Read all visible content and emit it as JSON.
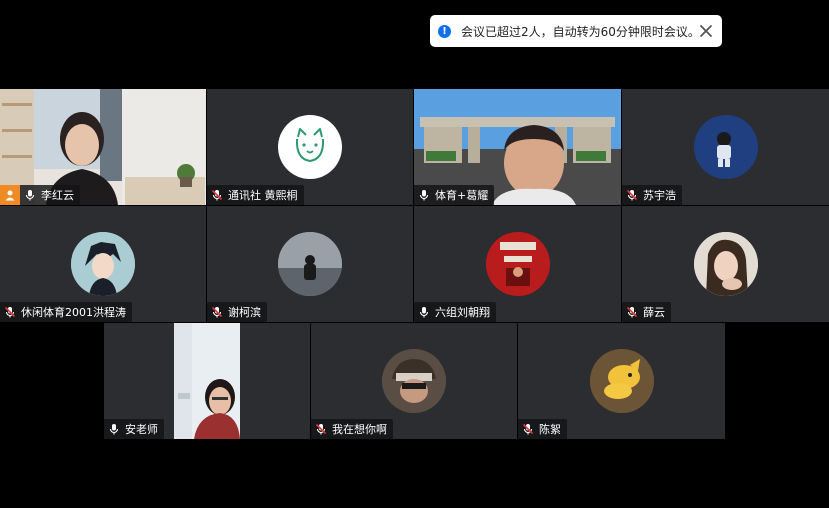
{
  "notification": {
    "message": "会议已超过2人，自动转为60分钟限时会议。",
    "info_icon": "info-icon",
    "close_icon": "close-icon"
  },
  "participants": [
    {
      "name": "李红云",
      "mic": "on",
      "host": true,
      "video": true
    },
    {
      "name": "通讯社 黄熙桐",
      "mic": "muted",
      "video": false,
      "avatar": "dog-icon"
    },
    {
      "name": "体育+葛耀",
      "mic": "on",
      "video": true,
      "speaking": true
    },
    {
      "name": "苏宇浩",
      "mic": "muted",
      "video": false
    },
    {
      "name": "休闲体育2001洪程涛",
      "mic": "muted",
      "video": false
    },
    {
      "name": "谢柯滨",
      "mic": "muted",
      "video": false
    },
    {
      "name": "六组刘朝翔",
      "mic": "on",
      "video": false
    },
    {
      "name": "薛云",
      "mic": "muted",
      "video": false
    },
    {
      "name": "安老师",
      "mic": "on",
      "video": true
    },
    {
      "name": "我在想你啊",
      "mic": "muted",
      "video": false
    },
    {
      "name": "陈絮",
      "mic": "muted",
      "video": false
    }
  ],
  "colors": {
    "tile_bg": "#2b2d30",
    "active_border": "#23d959",
    "host_badge": "#f08a24",
    "muted_red": "#e0393e",
    "info_blue": "#0e71eb"
  }
}
